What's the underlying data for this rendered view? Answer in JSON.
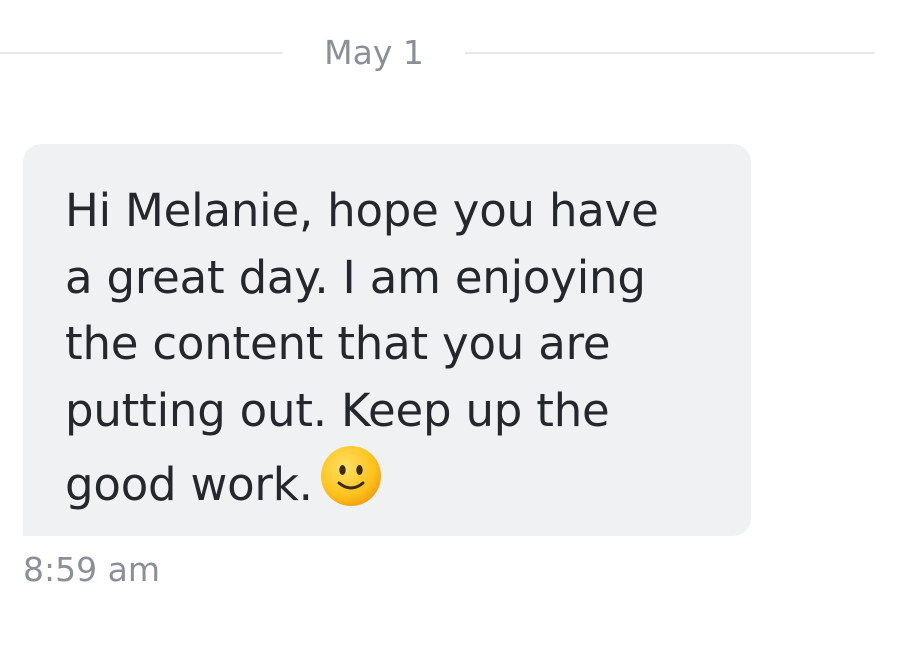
{
  "divider": {
    "date": "May 1"
  },
  "message": {
    "lines": [
      "Hi Melanie, hope you have",
      "a great day. I am enjoying",
      "the content that you are",
      "putting out. Keep up the",
      "good work."
    ],
    "emoji": "slightly-smiling-face-icon",
    "timestamp": "8:59 am"
  },
  "colors": {
    "background": "#ffffff",
    "bubble": "#f0f1f3",
    "text": "#24272b",
    "muted": "#8b9098",
    "divider_line": "#e6e7ea",
    "emoji_face": "#fcc21b"
  }
}
